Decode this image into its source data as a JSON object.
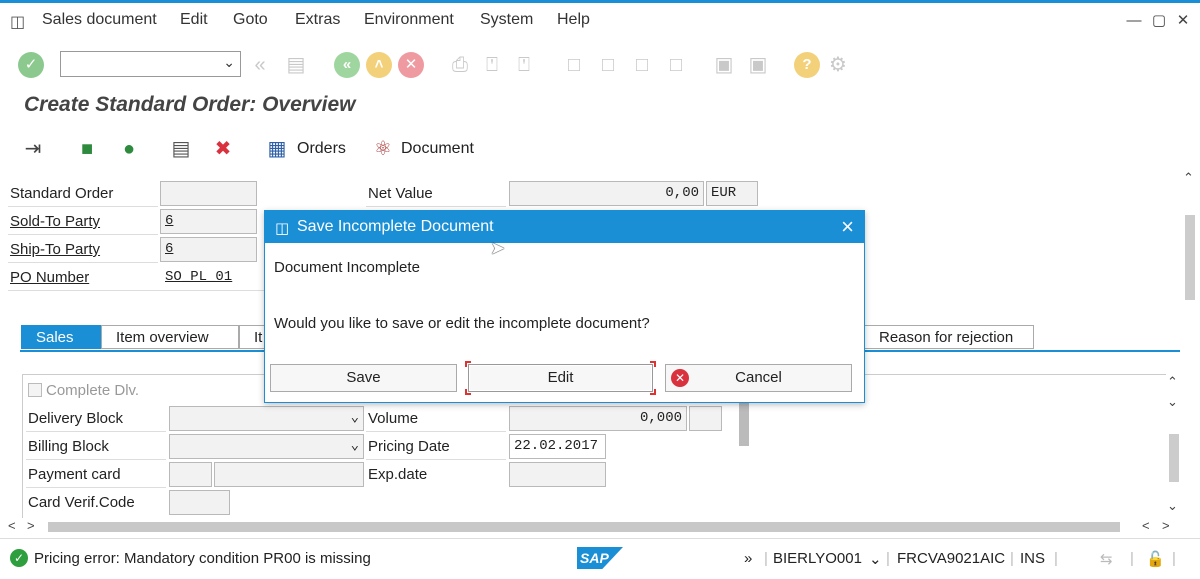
{
  "menu": {
    "items": [
      "Sales document",
      "Edit",
      "Goto",
      "Extras",
      "Environment",
      "System",
      "Help"
    ]
  },
  "window_controls": {
    "minimize": "—",
    "maximize": "▢",
    "close": "✕"
  },
  "page_title": "Create Standard Order: Overview",
  "app_toolbar": {
    "orders_label": "Orders",
    "document_label": "Document"
  },
  "header": {
    "standard_order_label": "Standard Order",
    "standard_order_value": "",
    "sold_to_label": "Sold-To Party",
    "sold_to_value": "6",
    "ship_to_label": "Ship-To Party",
    "ship_to_value": "6",
    "po_number_label": "PO Number",
    "po_number_value": "SO_PL_01",
    "net_value_label": "Net Value",
    "net_value": "0,00",
    "currency": "EUR"
  },
  "tabs": [
    "Sales",
    "Item overview",
    "It",
    "Reason for rejection"
  ],
  "sales_tab": {
    "complete_dlv_label": "Complete Dlv.",
    "delivery_block_label": "Delivery Block",
    "billing_block_label": "Billing Block",
    "payment_card_label": "Payment card",
    "card_verif_label": "Card Verif.Code",
    "volume_label": "Volume",
    "volume_value": "0,000",
    "pricing_date_label": "Pricing Date",
    "pricing_date_value": "22.02.2017",
    "exp_date_label": "Exp.date"
  },
  "dialog": {
    "title": "Save Incomplete Document",
    "heading": "Document Incomplete",
    "question": "Would you like to save or edit the incomplete document?",
    "save_label": "Save",
    "edit_label": "Edit",
    "cancel_label": "Cancel"
  },
  "status_bar": {
    "message": "Pricing error: Mandatory condition PR00 is missing",
    "sap_logo": "SAP",
    "user": "BIERLYO001",
    "transaction": "FRCVA9021AIC",
    "mode": "INS"
  },
  "colors": {
    "accent": "#1a8fd6",
    "ok_green": "#2e9e3e",
    "error_red": "#d9323e"
  }
}
